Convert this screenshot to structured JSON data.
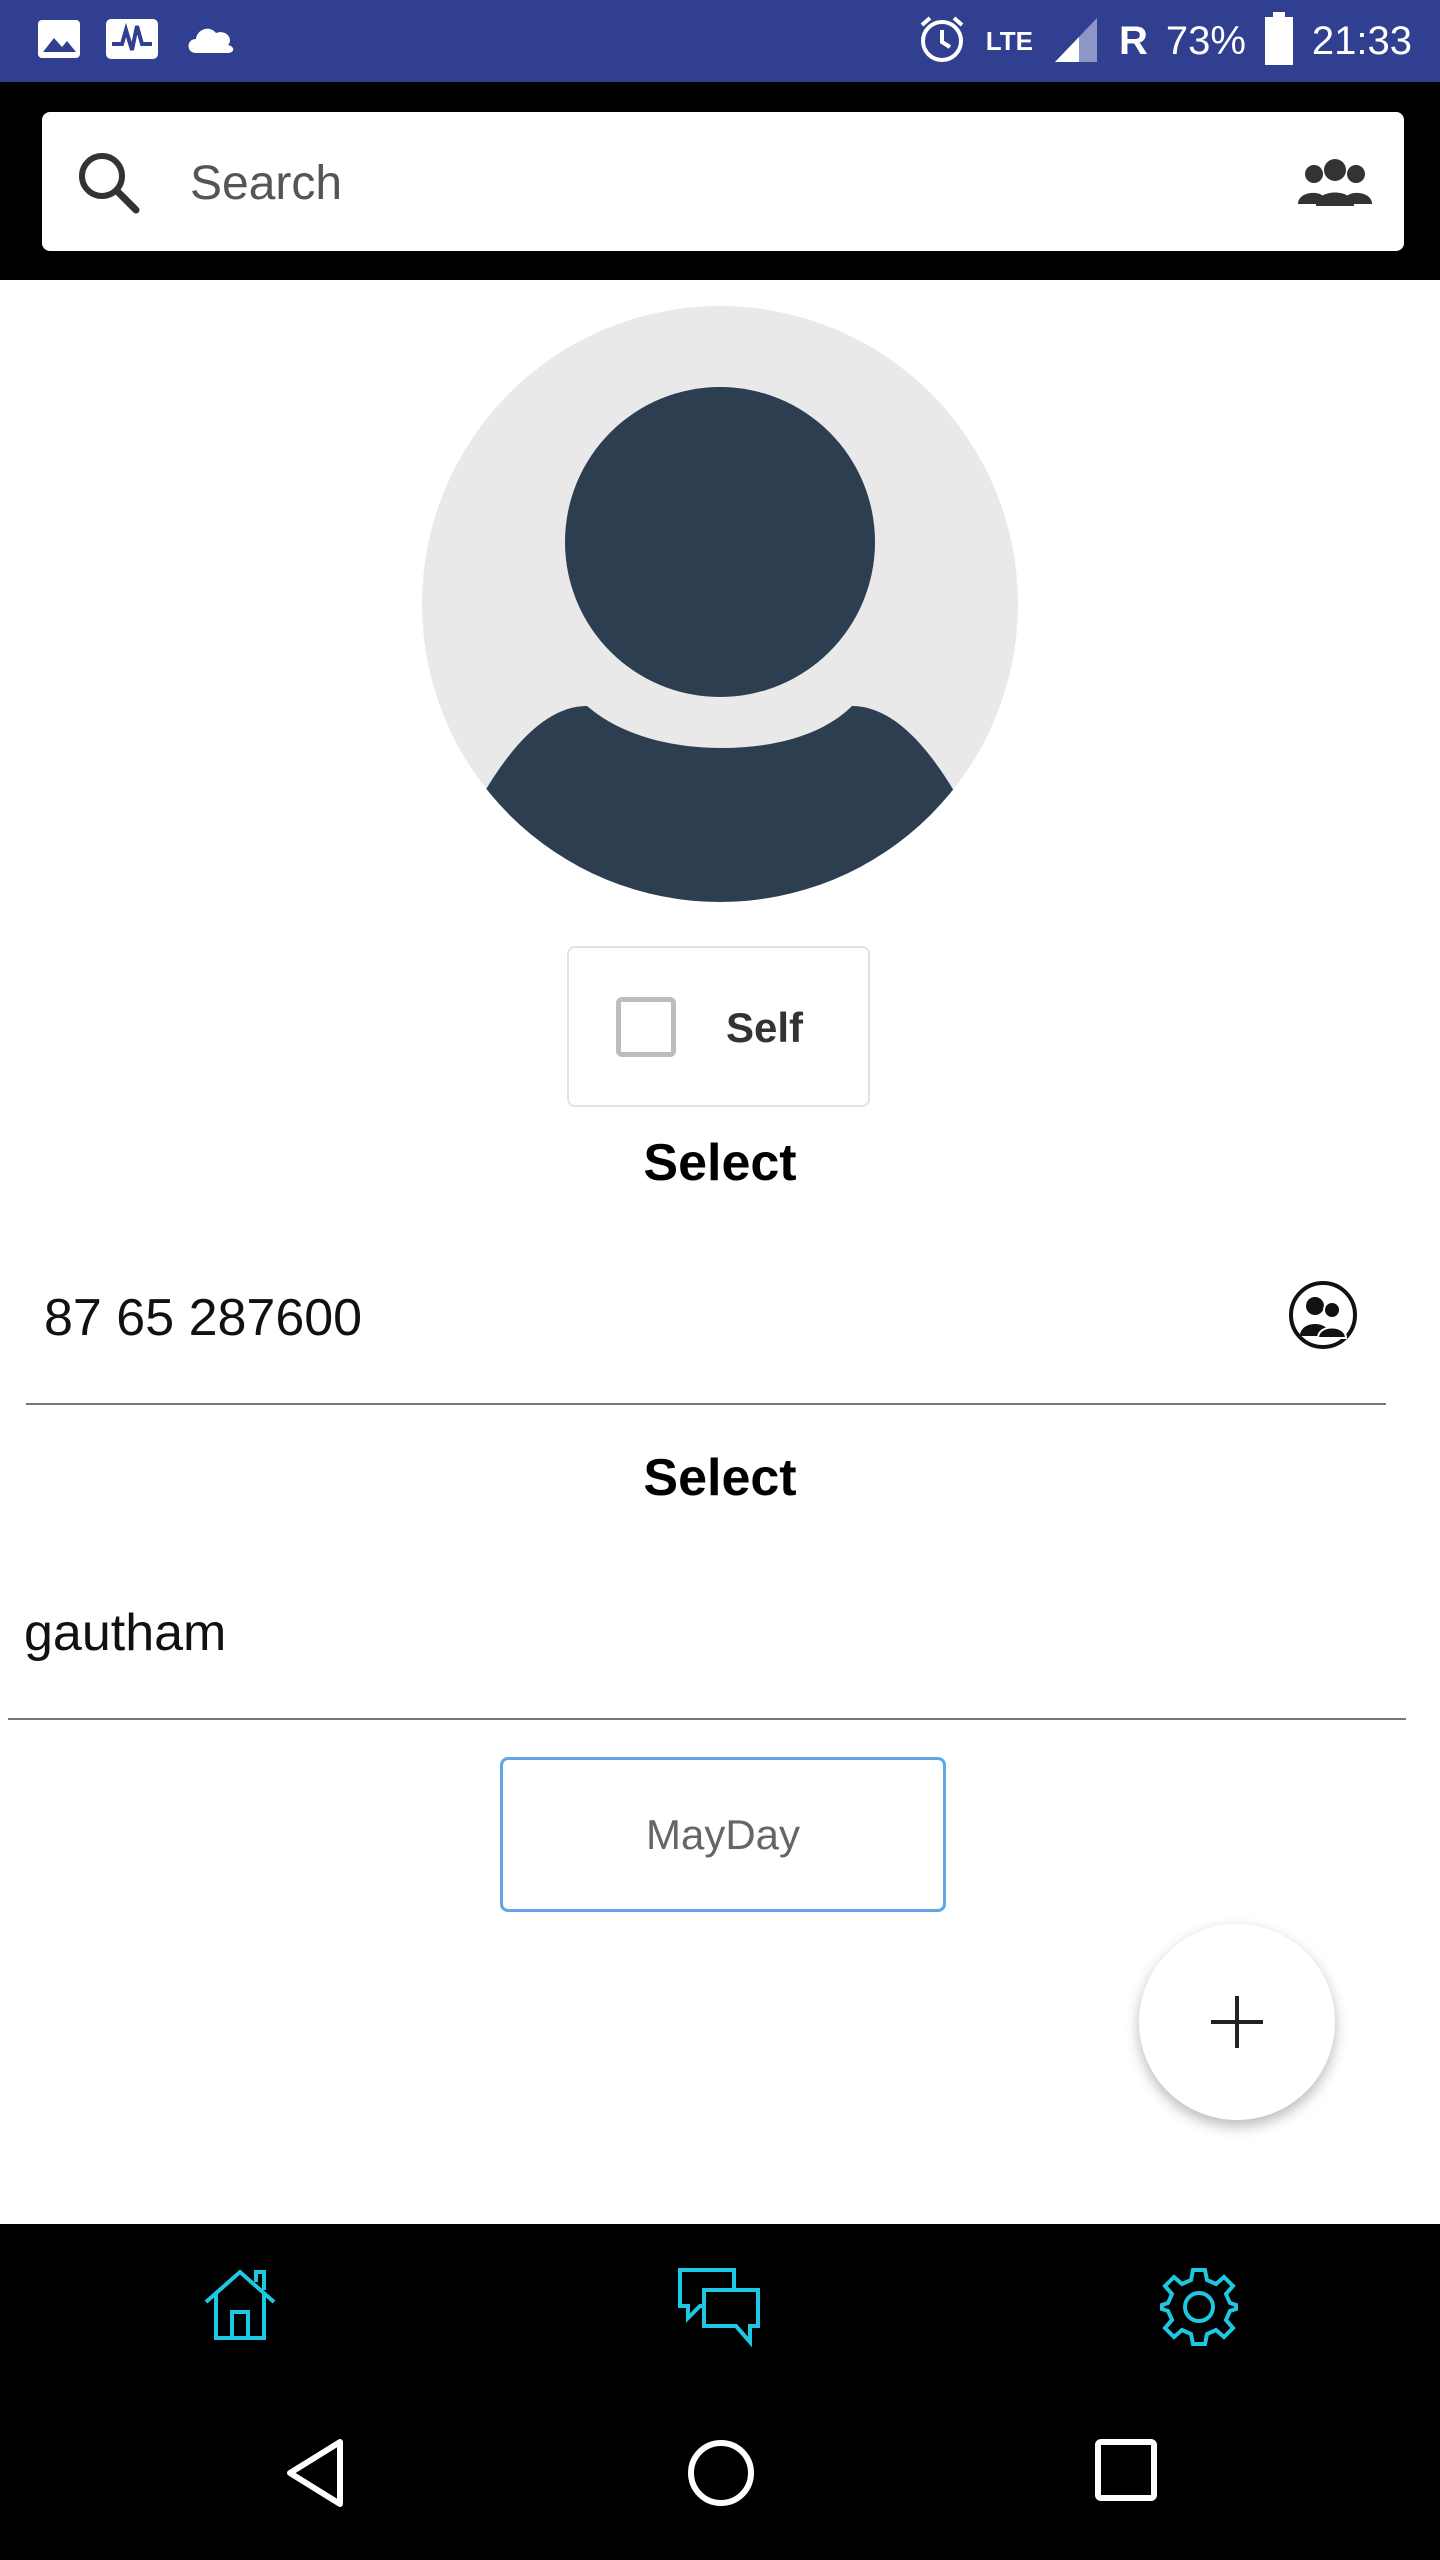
{
  "status_bar": {
    "network": "LTE",
    "roaming": "R",
    "battery": "73%",
    "time": "21:33"
  },
  "search": {
    "placeholder": "Search"
  },
  "self_option": {
    "label": "Self",
    "checked": false
  },
  "contact_section": {
    "heading": "Select",
    "phone": "87 65 287600"
  },
  "name_section": {
    "heading": "Select",
    "name": "gautham"
  },
  "mayday_button": {
    "label": "MayDay"
  },
  "colors": {
    "status_bar": "#303f8f",
    "nav_accent": "#1ec8e0",
    "mayday_border": "#5ea6e4",
    "avatar_fill": "#2e3e51"
  },
  "bottom_nav": {
    "items": [
      "home-icon",
      "chat-icon",
      "settings-icon"
    ]
  }
}
